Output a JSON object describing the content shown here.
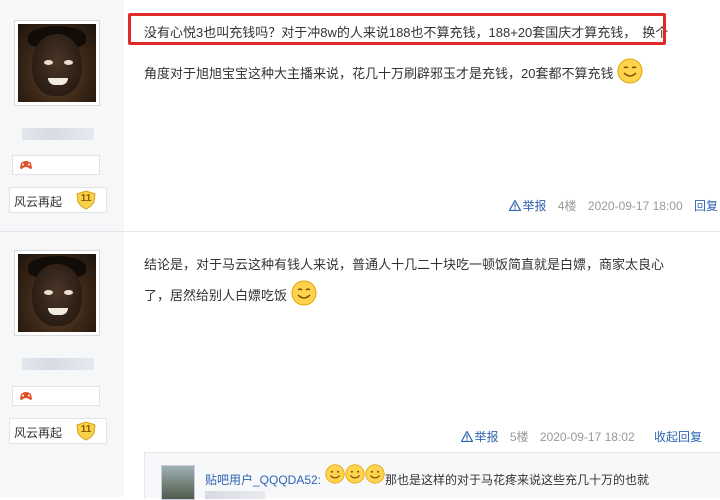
{
  "posts": [
    {
      "user": {
        "level_name": "风云再起",
        "level": "11"
      },
      "highlighted_text": "没有心悦3也叫充钱吗？对于冲8w的人来说188也不算充钱，188+20套国庆才算充钱，",
      "line1_rest": "换个",
      "line2": "角度对于旭旭宝宝这种大主播来说，花几十万刷辟邪玉才是充钱，20套都不算充钱",
      "report_label": "举报",
      "floor": "4楼",
      "timestamp": "2020-09-17 18:00",
      "reply_label": "回复"
    },
    {
      "user": {
        "level_name": "风云再起",
        "level": "11"
      },
      "line1": "结论是，对于马云这种有钱人来说，普通人十几二十块吃一顿饭简直就是白嫖，商家太良心",
      "line2": "了，居然给别人白嫖吃饭",
      "report_label": "举报",
      "floor": "5楼",
      "timestamp": "2020-09-17 18:02",
      "reply_label": "收起回复",
      "sub_reply": {
        "user": "贴吧用户_QQQDA52:",
        "text": "那也是这样的对于马花疼来说这些充几十万的也就"
      }
    }
  ],
  "colors": {
    "highlight": "#e02a2a",
    "link": "#2d64b3",
    "sidebar": "#f6f7f9"
  },
  "icons": [
    "game-controller-icon",
    "level-shield-icon",
    "smiley-emoji-icon",
    "report-warning-icon"
  ]
}
